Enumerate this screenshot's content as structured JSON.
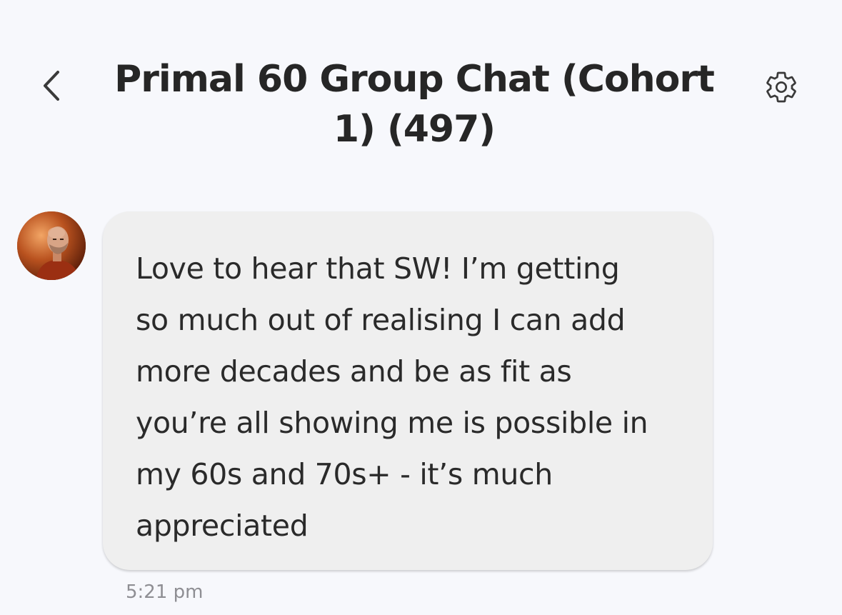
{
  "header": {
    "title": "Primal 60 Group Chat (Cohort 1) (497)",
    "back_icon": "chevron-left-icon",
    "settings_icon": "gear-icon"
  },
  "messages": [
    {
      "avatar": "avatar",
      "text": "Love to hear that SW!  I’m getting\nso much out of realising I can add\nmore decades and be as fit as\nyou’re all showing me is possible in\nmy 60s and 70s+ - it’s much\nappreciated",
      "time": "5:21 pm"
    }
  ],
  "colors": {
    "background": "#f7f8fc",
    "bubble": "#efefef",
    "text": "#262626",
    "timestamp": "#8e8e93"
  }
}
